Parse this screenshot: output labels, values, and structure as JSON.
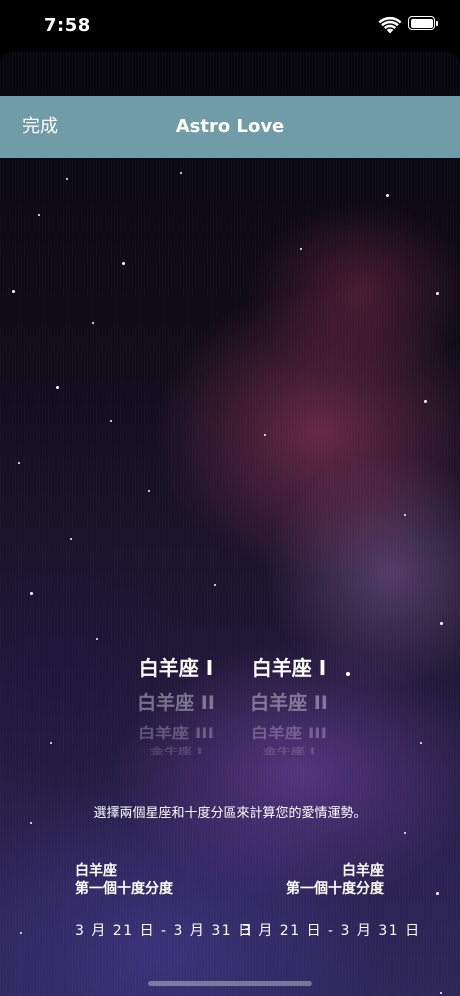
{
  "status_bar": {
    "time": "7:58",
    "wifi_icon": "wifi-icon",
    "battery_icon": "battery-full-icon"
  },
  "nav": {
    "done_label": "完成",
    "title": "Astro Love",
    "bar_color": "#6f9ca6"
  },
  "picker": {
    "left": {
      "selected": "白羊座 I",
      "rows": [
        "白羊座 II",
        "白羊座 III",
        "金牛座 I"
      ]
    },
    "right": {
      "selected": "白羊座 I",
      "rows": [
        "白羊座 II",
        "白羊座 III",
        "金牛座 I"
      ]
    }
  },
  "info_text": "選擇兩個星座和十度分區來計算您的愛情運勢。",
  "left_sign": {
    "name": "白羊座",
    "decan": "第一個十度分度",
    "dates": "3 月 21 日 - 3 月 31 日"
  },
  "right_sign": {
    "name": "白羊座",
    "decan": "第一個十度分度",
    "dates": "3 月 21 日 - 3 月 31 日"
  }
}
